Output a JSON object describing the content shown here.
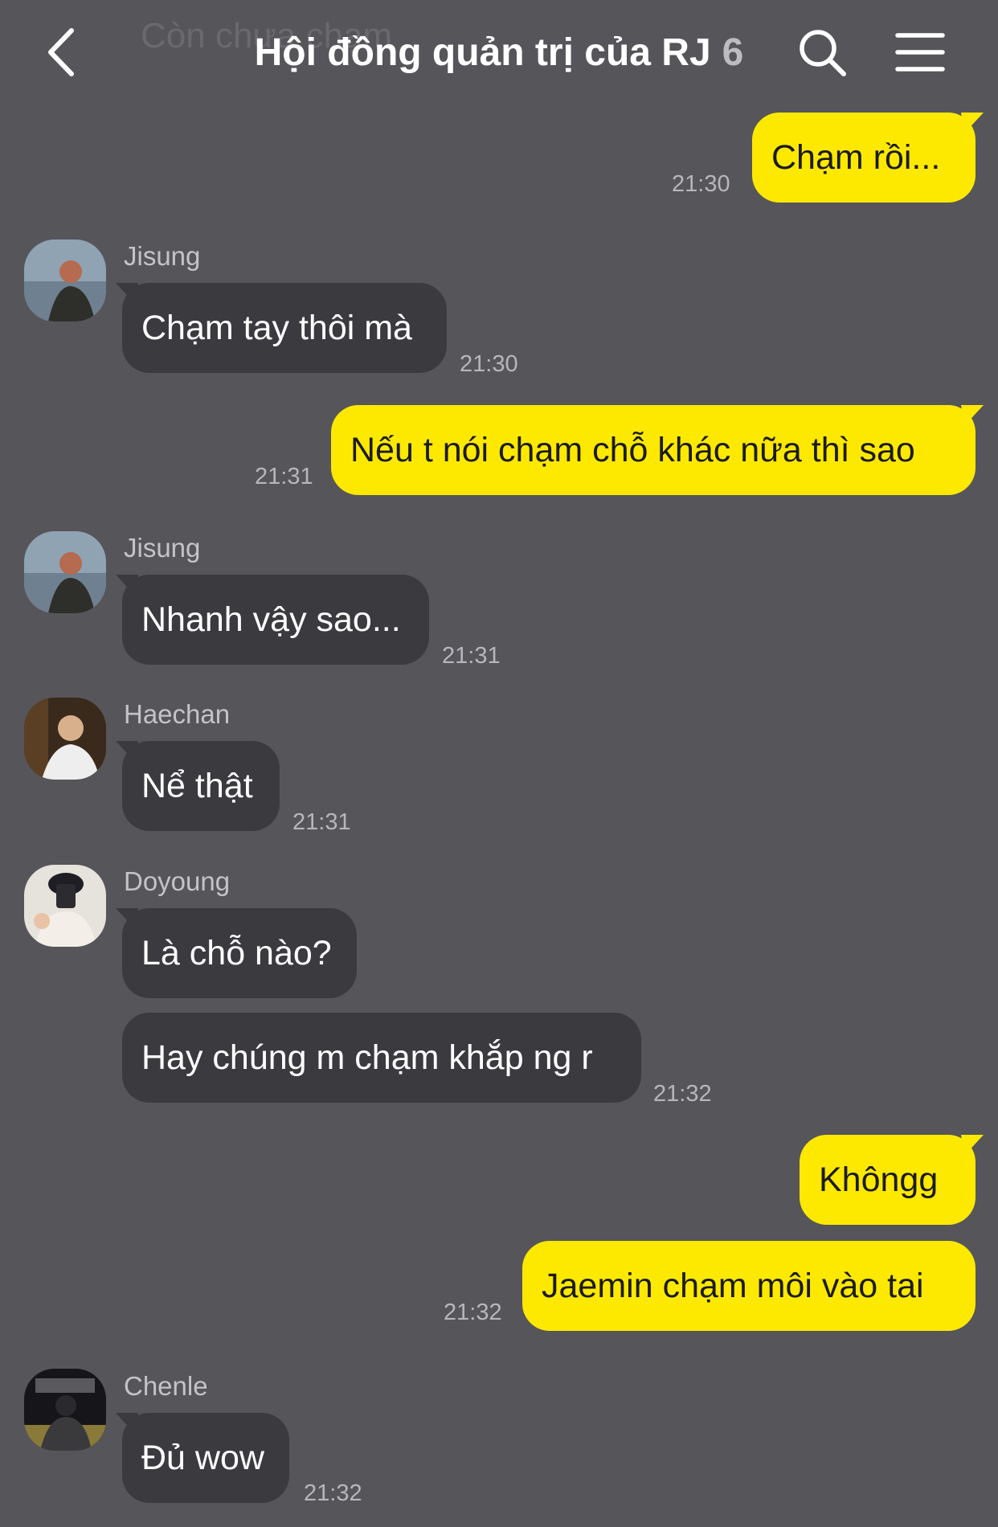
{
  "header": {
    "ghost_text": "Còn chưa chạm",
    "title": "Hội đồng quản trị của RJ",
    "member_count": "6",
    "back_icon": "chevron-left-icon",
    "search_icon": "search-icon",
    "menu_icon": "hamburger-menu-icon"
  },
  "messages": [
    {
      "text": "Chạm rồi...",
      "time": "21:30"
    },
    {
      "sender": "Jisung",
      "text": "Chạm tay thôi mà",
      "time": "21:30"
    },
    {
      "text": "Nếu t nói chạm chỗ khác nữa thì sao",
      "time": "21:31"
    },
    {
      "sender": "Jisung",
      "text": "Nhanh vậy sao...",
      "time": "21:31"
    },
    {
      "sender": "Haechan",
      "text": "Nể thật",
      "time": "21:31"
    },
    {
      "sender": "Doyoung",
      "text": "Là chỗ nào?"
    },
    {
      "text": "Hay chúng m chạm khắp ng r",
      "time": "21:32"
    },
    {
      "text": "Khôngg"
    },
    {
      "text": "Jaemin chạm môi vào tai",
      "time": "21:32"
    },
    {
      "sender": "Chenle",
      "text": "Đủ wow",
      "time": "21:32"
    }
  ],
  "colors": {
    "background": "#56555a",
    "outgoing_bubble": "#fde900",
    "incoming_bubble": "#3b3a3f"
  }
}
